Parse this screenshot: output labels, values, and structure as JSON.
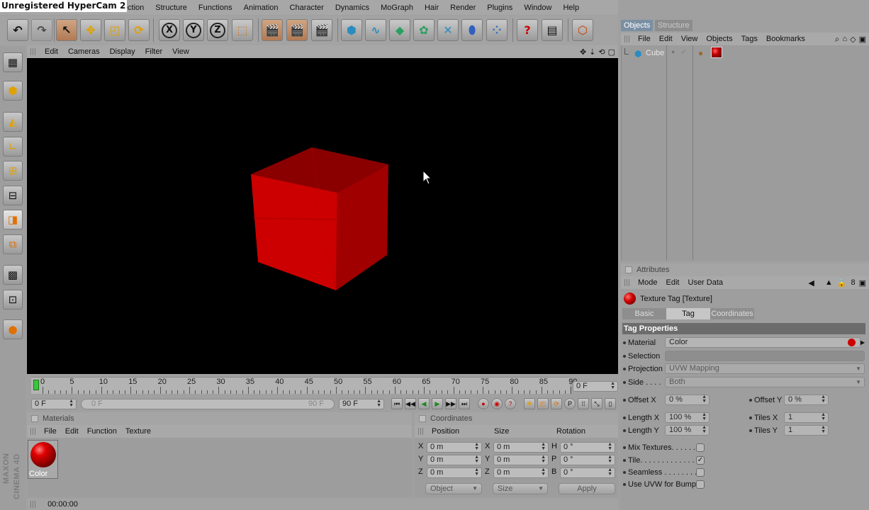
{
  "hypercam_label": "Unregistered HyperCam 2",
  "menu": [
    "Selection",
    "Structure",
    "Functions",
    "Animation",
    "Character",
    "Dynamics",
    "MoGraph",
    "Hair",
    "Render",
    "Plugins",
    "Window",
    "Help"
  ],
  "toolbar": {
    "x_label": "X",
    "y_label": "Y",
    "z_label": "Z"
  },
  "viewport": {
    "menu": [
      "Edit",
      "Cameras",
      "Display",
      "Filter",
      "View"
    ],
    "cube_color": "#c00000"
  },
  "timeline": {
    "ticks": [
      "0",
      "5",
      "10",
      "15",
      "20",
      "25",
      "30",
      "35",
      "40",
      "45",
      "50",
      "55",
      "60",
      "65",
      "70",
      "75",
      "80",
      "85",
      "90"
    ],
    "current_frame": "0 F",
    "start_frame": "0 F",
    "range_start": "0 F",
    "range_end": "90 F",
    "end_frame": "90 F"
  },
  "materials": {
    "title": "Materials",
    "menu": [
      "File",
      "Edit",
      "Function",
      "Texture"
    ],
    "swatch_label": "Color"
  },
  "coordinates": {
    "title": "Coordinates",
    "col_position": "Position",
    "col_size": "Size",
    "col_rotation": "Rotation",
    "rows": [
      {
        "a": "X",
        "pos": "0 m",
        "b": "X",
        "size": "0 m",
        "c": "H",
        "rot": "0 °"
      },
      {
        "a": "Y",
        "pos": "0 m",
        "b": "Y",
        "size": "0 m",
        "c": "P",
        "rot": "0 °"
      },
      {
        "a": "Z",
        "pos": "0 m",
        "b": "Z",
        "size": "0 m",
        "c": "B",
        "rot": "0 °"
      }
    ],
    "mode_select": "Object",
    "size_select": "Size",
    "apply_label": "Apply"
  },
  "status": {
    "time": "00:00:00"
  },
  "branding": "MAXON CINEMA 4D",
  "objects": {
    "tab_objects": "Objects",
    "tab_structure": "Structure",
    "menu": [
      "File",
      "Edit",
      "View",
      "Objects",
      "Tags",
      "Bookmarks"
    ],
    "item_name": "Cube"
  },
  "attributes": {
    "title": "Attributes",
    "menu": [
      "Mode",
      "Edit",
      "User Data"
    ],
    "object_title": "Texture Tag [Texture]",
    "tabs": [
      "Basic",
      "Tag",
      "Coordinates"
    ],
    "section": "Tag Properties",
    "material_label": "Material",
    "material_value": "Color",
    "selection_label": "Selection",
    "selection_value": "",
    "projection_label": "Projection",
    "projection_value": "UVW Mapping",
    "side_label": "Side . . . .",
    "side_value": "Both",
    "offset_x_label": "Offset X",
    "offset_x_value": "0 %",
    "offset_y_label": "Offset Y",
    "offset_y_value": "0 %",
    "length_x_label": "Length X",
    "length_x_value": "100 %",
    "tiles_x_label": "Tiles X",
    "tiles_x_value": "1",
    "length_y_label": "Length Y",
    "length_y_value": "100 %",
    "tiles_y_label": "Tiles Y",
    "tiles_y_value": "1",
    "mix_textures_label": "Mix Textures. . . . . .",
    "tile_label": "Tile. . . . . . . . . . . . . .",
    "seamless_label": "Seamless . . . . . . . .",
    "uvw_bump_label": "Use UVW for Bump",
    "tile_checked": "✓"
  }
}
